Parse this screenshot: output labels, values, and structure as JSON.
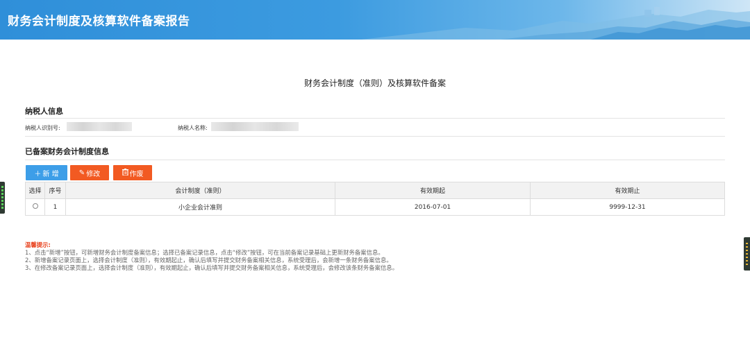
{
  "header": {
    "title": "财务会计制度及核算软件备案报告"
  },
  "form": {
    "title": "财务会计制度（准则）及核算软件备案"
  },
  "taxpayer": {
    "section_title": "纳税人信息",
    "id_label": "纳税人识别号:",
    "name_label": "纳税人名称:"
  },
  "records": {
    "section_title": "已备案财务会计制度信息",
    "buttons": {
      "add": "新 增",
      "edit": "修改",
      "void": "作废"
    },
    "columns": [
      "选择",
      "序号",
      "会计制度（准则）",
      "有效期起",
      "有效期止"
    ],
    "rows": [
      {
        "no": "1",
        "rule": "小企业会计准则",
        "start": "2016-07-01",
        "end": "9999-12-31"
      }
    ]
  },
  "tips": {
    "title": "温馨提示:",
    "lines": [
      "1、点击“新增”按钮，可新增财务会计制度备案信息；选择已备案记录信息，点击“修改”按钮，可在当前备案记录基础上更新财务备案信息。",
      "2、新增备案记录页面上，选择会计制度（准则），有效期起止，确认后填写并提交财务备案相关信息，系统受理后，会新增一条财务备案信息。",
      "3、在修改备案记录页面上，选择会计制度（准则），有效期起止，确认后填写并提交财务备案相关信息，系统受理后，会修改该条财务备案信息。"
    ]
  },
  "colors": {
    "header_blue": "#2f8fd9",
    "primary_button": "#3d9ee8",
    "danger_button": "#f25a22",
    "tips_title": "#e8401c"
  }
}
